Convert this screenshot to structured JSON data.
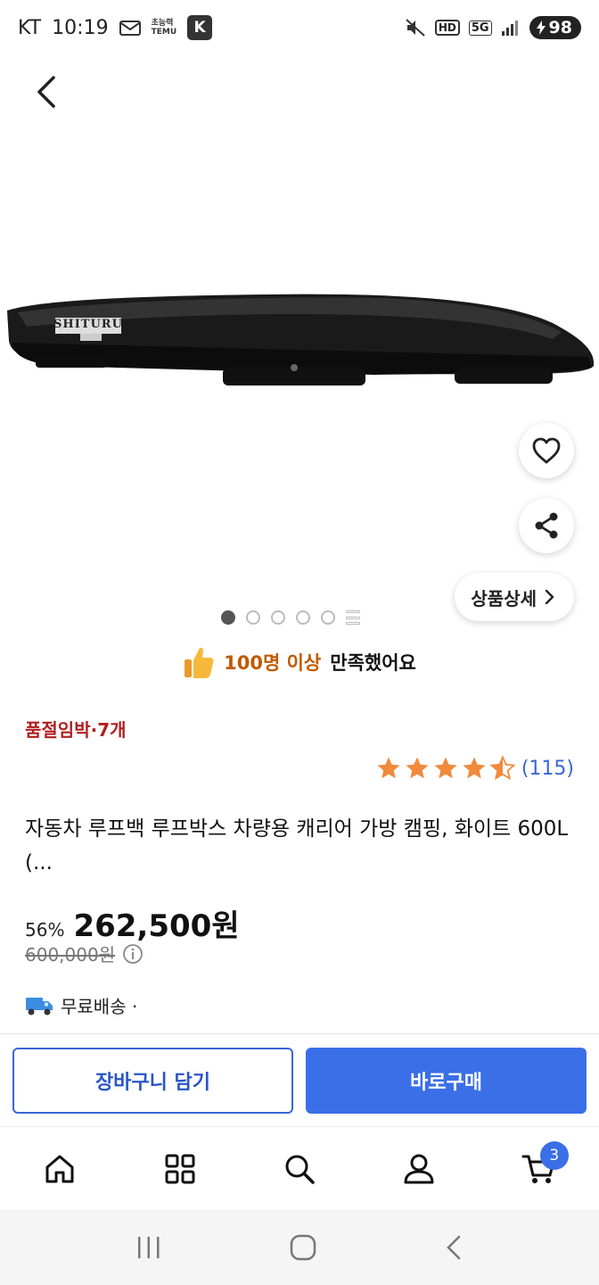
{
  "status_bar": {
    "carrier": "KT",
    "time": "10:19",
    "temu_label": "TEMU",
    "temu_top": "초능력",
    "k_logo": "K",
    "network": "5G",
    "hd": "HD",
    "battery": "98"
  },
  "product": {
    "image_brand": "SHITURU",
    "detail_label": "상품상세",
    "satisfied_highlight": "100명 이상",
    "satisfied_rest": "만족했어요",
    "soldout": "품절임박·7개",
    "rating": 4.5,
    "review_count": "(115)",
    "title": "자동차 루프백 루프박스 차량용 캐리어 가방 캠핑, 화이트 600L (...",
    "discount": "56%",
    "price": "262,500원",
    "original_price": "600,000원",
    "shipping": "무료배송 ·",
    "pager_total": 5,
    "pager_active": 0
  },
  "cta": {
    "cart_label": "장바구니 담기",
    "buy_label": "바로구매"
  },
  "nav": {
    "cart_count": "3"
  },
  "colors": {
    "accent": "#3a6fe8",
    "soldout": "#b02020",
    "star": "#f08a3c",
    "highlight": "#c05a00"
  }
}
